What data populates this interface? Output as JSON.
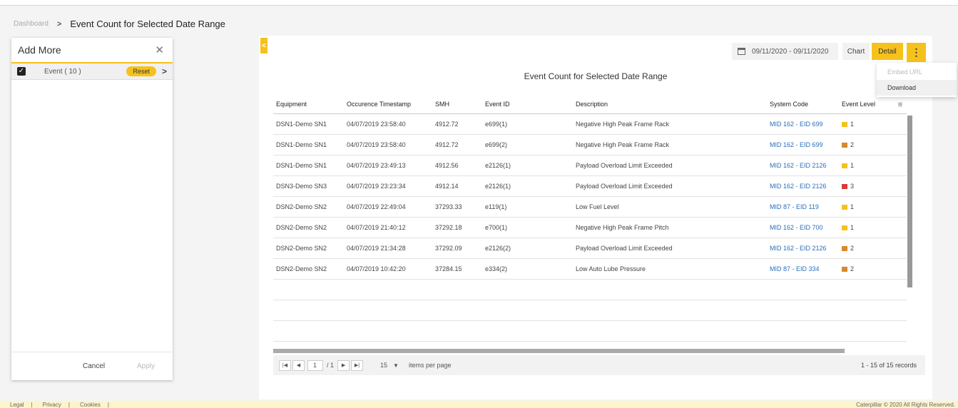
{
  "breadcrumb": {
    "home": "Dashboard",
    "separator": ">",
    "current": "Event Count for Selected Date Range"
  },
  "add_more": {
    "title": "Add More",
    "close_icon": "close-icon",
    "item": {
      "label": "Event ( 10 )",
      "checked": true,
      "reset_label": "Reset"
    },
    "cancel_label": "Cancel",
    "apply_label": "Apply"
  },
  "toolbar": {
    "date_range": "09/11/2020 - 09/11/2020",
    "chart_label": "Chart",
    "detail_label": "Detail",
    "more_icon": "more-vertical-icon"
  },
  "menu": {
    "embed_url": "Embed URL",
    "download": "Download"
  },
  "grid": {
    "title": "Event Count for Selected Date Range",
    "columns": [
      "Equipment",
      "Occurence Timestamp",
      "SMH",
      "Event ID",
      "Description",
      "System Code",
      "Event Level"
    ],
    "rows": [
      [
        "DSN1-Demo SN1",
        "04/07/2019 23:58:40",
        "4912.72",
        "e699(1)",
        "Negative High Peak Frame Rack",
        "MID 162 - EID 699",
        "1"
      ],
      [
        "DSN1-Demo SN1",
        "04/07/2019 23:58:40",
        "4912.72",
        "e699(2)",
        "Negative High Peak Frame Rack",
        "MID 162 - EID 699",
        "2"
      ],
      [
        "DSN1-Demo SN1",
        "04/07/2019 23:49:13",
        "4912.56",
        "e2126(1)",
        "Payload Overload Limit Exceeded",
        "MID 162 - EID 2126",
        "1"
      ],
      [
        "DSN3-Demo SN3",
        "04/07/2019 23:23:34",
        "4912.14",
        "e2126(1)",
        "Payload Overload Limit Exceeded",
        "MID 162 - EID 2126",
        "3"
      ],
      [
        "DSN2-Demo SN2",
        "04/07/2019 22:49:04",
        "37293.33",
        "e119(1)",
        "Low Fuel Level",
        "MID 87 - EID 119",
        "1"
      ],
      [
        "DSN2-Demo SN2",
        "04/07/2019 21:40:12",
        "37292.18",
        "e700(1)",
        "Negative High Peak Frame Pitch",
        "MID 162 - EID 700",
        "1"
      ],
      [
        "DSN2-Demo SN2",
        "04/07/2019 21:34:28",
        "37292.09",
        "e2126(2)",
        "Payload Overload Limit Exceeded",
        "MID 162 - EID 2126",
        "2"
      ],
      [
        "DSN2-Demo SN2",
        "04/07/2019 10:42:20",
        "37284.15",
        "e334(2)",
        "Low Auto Lube Pressure",
        "MID 87 - EID 334",
        "2"
      ]
    ],
    "level_colors": {
      "1": "#f5c21d",
      "2": "#d9882a",
      "3": "#d9383a"
    }
  },
  "pager": {
    "current_page": "1",
    "total_pages": "/ 1",
    "page_size": "15",
    "items_per_page": "items per page",
    "records": "1 - 15 of 15 records"
  },
  "footer": {
    "legal": "Legal",
    "privacy": "Privacy",
    "cookies": "Cookies",
    "copyright": "Caterpillar © 2020 All Rights Reserved."
  }
}
